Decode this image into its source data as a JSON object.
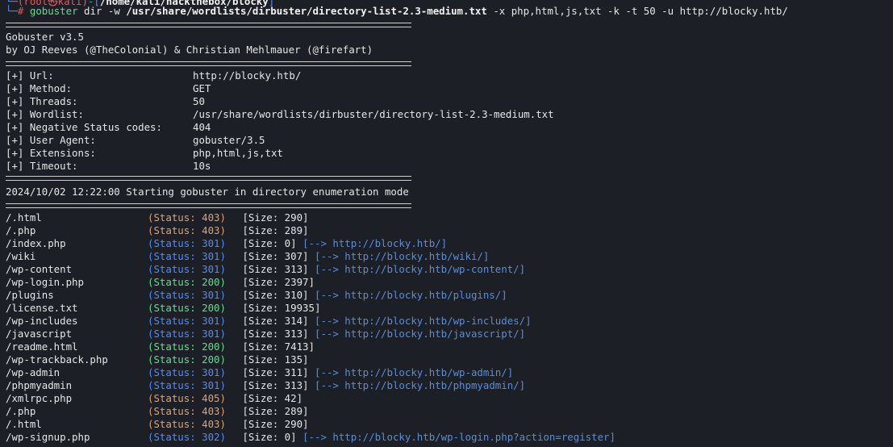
{
  "prompt": {
    "path_fragment": "/home/kali/hackthebox/blocky",
    "command": "gobuster",
    "arg_dir": "dir -w",
    "wordlist_arg": "/usr/share/wordlists/dirbuster/directory-list-2.3-medium.txt",
    "rest": "-x php,html,js,txt -k -t 50 -u http://blocky.htb/"
  },
  "banner": {
    "title": "Gobuster v3.5",
    "credits": "by OJ Reeves (@TheColonial) & Christian Mehlmauer (@firefart)"
  },
  "config": [
    {
      "label": "[+] Url:",
      "value": "http://blocky.htb/"
    },
    {
      "label": "[+] Method:",
      "value": "GET"
    },
    {
      "label": "[+] Threads:",
      "value": "50"
    },
    {
      "label": "[+] Wordlist:",
      "value": "/usr/share/wordlists/dirbuster/directory-list-2.3-medium.txt"
    },
    {
      "label": "[+] Negative Status codes:",
      "value": "404"
    },
    {
      "label": "[+] User Agent:",
      "value": "gobuster/3.5"
    },
    {
      "label": "[+] Extensions:",
      "value": "php,html,js,txt"
    },
    {
      "label": "[+] Timeout:",
      "value": "10s"
    }
  ],
  "start_message": "2024/10/02 12:22:00 Starting gobuster in directory enumeration mode",
  "results": [
    {
      "path": "/.html",
      "status": "403",
      "size": "290",
      "redirect": ""
    },
    {
      "path": "/.php",
      "status": "403",
      "size": "289",
      "redirect": ""
    },
    {
      "path": "/index.php",
      "status": "301",
      "size": "0",
      "redirect": "http://blocky.htb/"
    },
    {
      "path": "/wiki",
      "status": "301",
      "size": "307",
      "redirect": "http://blocky.htb/wiki/"
    },
    {
      "path": "/wp-content",
      "status": "301",
      "size": "313",
      "redirect": "http://blocky.htb/wp-content/"
    },
    {
      "path": "/wp-login.php",
      "status": "200",
      "size": "2397",
      "redirect": ""
    },
    {
      "path": "/plugins",
      "status": "301",
      "size": "310",
      "redirect": "http://blocky.htb/plugins/"
    },
    {
      "path": "/license.txt",
      "status": "200",
      "size": "19935",
      "redirect": ""
    },
    {
      "path": "/wp-includes",
      "status": "301",
      "size": "314",
      "redirect": "http://blocky.htb/wp-includes/"
    },
    {
      "path": "/javascript",
      "status": "301",
      "size": "313",
      "redirect": "http://blocky.htb/javascript/"
    },
    {
      "path": "/readme.html",
      "status": "200",
      "size": "7413",
      "redirect": ""
    },
    {
      "path": "/wp-trackback.php",
      "status": "200",
      "size": "135",
      "redirect": ""
    },
    {
      "path": "/wp-admin",
      "status": "301",
      "size": "311",
      "redirect": "http://blocky.htb/wp-admin/"
    },
    {
      "path": "/phpmyadmin",
      "status": "301",
      "size": "313",
      "redirect": "http://blocky.htb/phpmyadmin/"
    },
    {
      "path": "/xmlrpc.php",
      "status": "405",
      "size": "42",
      "redirect": ""
    },
    {
      "path": "/.php",
      "status": "403",
      "size": "289",
      "redirect": ""
    },
    {
      "path": "/.html",
      "status": "403",
      "size": "290",
      "redirect": ""
    },
    {
      "path": "/wp-signup.php",
      "status": "302",
      "size": "0",
      "redirect": "http://blocky.htb/wp-login.php?action=register"
    }
  ],
  "labels": {
    "status_open": "(Status: ",
    "status_close": ")",
    "size_open": "[Size: ",
    "size_close": "]",
    "arrow": "[-->",
    "redirect_close": "]"
  },
  "colors": {
    "background": "#1c1f26",
    "status_ok": "#5ee08f",
    "status_redirect": "#4f8cff",
    "status_forbidden": "#e0a273",
    "link": "#5a8dd8"
  }
}
